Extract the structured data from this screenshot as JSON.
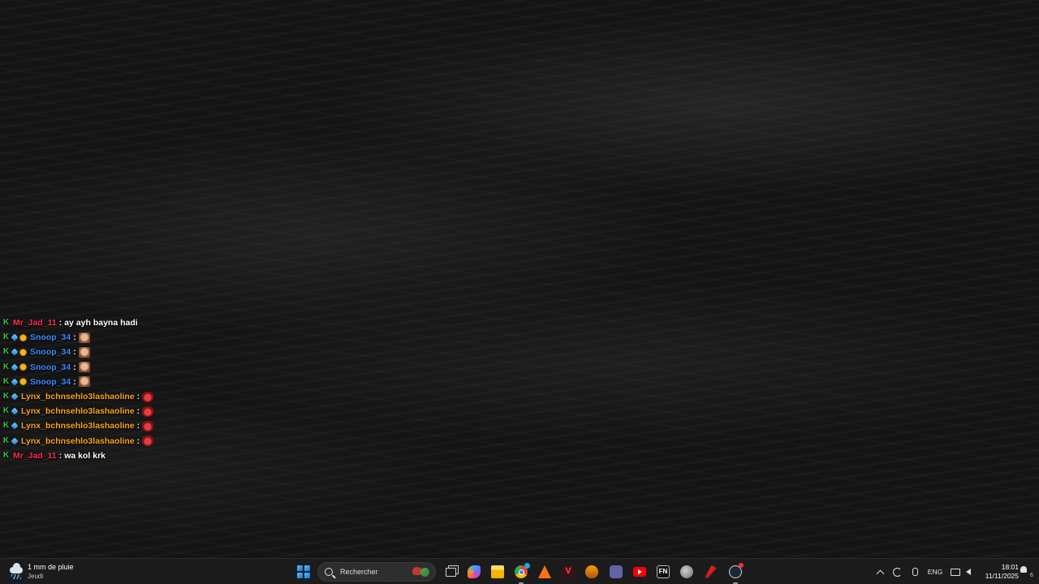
{
  "chat": {
    "rows": [
      {
        "user": "Mr_Jad_11",
        "user_color": "#ff2d55",
        "badges": [
          "k"
        ],
        "sep": ":",
        "message": "ay ayh bayna hadi",
        "emote": ""
      },
      {
        "user": "Snoop_34",
        "user_color": "#3b8bff",
        "badges": [
          "k",
          "cube",
          "coin"
        ],
        "sep": ":",
        "message": "",
        "emote": "face"
      },
      {
        "user": "Snoop_34",
        "user_color": "#3b8bff",
        "badges": [
          "k",
          "cube",
          "coin"
        ],
        "sep": ":",
        "message": "",
        "emote": "face"
      },
      {
        "user": "Snoop_34",
        "user_color": "#3b8bff",
        "badges": [
          "k",
          "cube",
          "coin"
        ],
        "sep": ":",
        "message": "",
        "emote": "face"
      },
      {
        "user": "Snoop_34",
        "user_color": "#3b8bff",
        "badges": [
          "k",
          "cube",
          "coin"
        ],
        "sep": ":",
        "message": "",
        "emote": "face"
      },
      {
        "user": "Lynx_bchnsehlo3lashaoline",
        "user_color": "#ffa31a",
        "badges": [
          "k",
          "cube"
        ],
        "sep": ":",
        "message": "",
        "emote": "demon"
      },
      {
        "user": "Lynx_bchnsehlo3lashaoline",
        "user_color": "#ffa31a",
        "badges": [
          "k",
          "cube"
        ],
        "sep": ":",
        "message": "",
        "emote": "demon"
      },
      {
        "user": "Lynx_bchnsehlo3lashaoline",
        "user_color": "#ffa31a",
        "badges": [
          "k",
          "cube"
        ],
        "sep": ":",
        "message": "",
        "emote": "demon"
      },
      {
        "user": "Lynx_bchnsehlo3lashaoline",
        "user_color": "#ffa31a",
        "badges": [
          "k",
          "cube"
        ],
        "sep": ":",
        "message": "",
        "emote": "demon"
      },
      {
        "user": "Mr_Jad_11",
        "user_color": "#ff2d55",
        "badges": [
          "k"
        ],
        "sep": ":",
        "message": "wa kol krk",
        "emote": ""
      }
    ]
  },
  "taskbar": {
    "weather": {
      "line1": "1 mm de pluie",
      "line2": "Jeudi",
      "icon": "rain-cloud-icon"
    },
    "search": {
      "label": "Rechercher"
    },
    "apps": [
      {
        "name": "task-view",
        "icon": "task-view-icon"
      },
      {
        "name": "copilot",
        "icon": "copilot-icon"
      },
      {
        "name": "file-explorer",
        "icon": "folder-icon"
      },
      {
        "name": "chrome",
        "icon": "chrome-icon"
      },
      {
        "name": "orange-app",
        "icon": "triangle-app-icon"
      },
      {
        "name": "valorant",
        "icon": "valorant-icon"
      },
      {
        "name": "shield-app",
        "icon": "shield-icon"
      },
      {
        "name": "teams",
        "icon": "teams-icon"
      },
      {
        "name": "youtube",
        "icon": "youtube-icon"
      },
      {
        "name": "fn-app",
        "icon": "fn-icon"
      },
      {
        "name": "fruit-app",
        "icon": "fruit-icon"
      },
      {
        "name": "feather-app",
        "icon": "feather-icon"
      },
      {
        "name": "steam",
        "icon": "steam-icon"
      }
    ],
    "tray": {
      "language": "ENG",
      "time": "18:01",
      "date": "11/11/2025",
      "notification_count": "6"
    }
  },
  "colors": {
    "taskbar_bg": "#1c1c1c",
    "chat_mr_jad": "#ff2d55",
    "chat_snoop": "#3b8bff",
    "chat_lynx": "#ffa31a"
  }
}
